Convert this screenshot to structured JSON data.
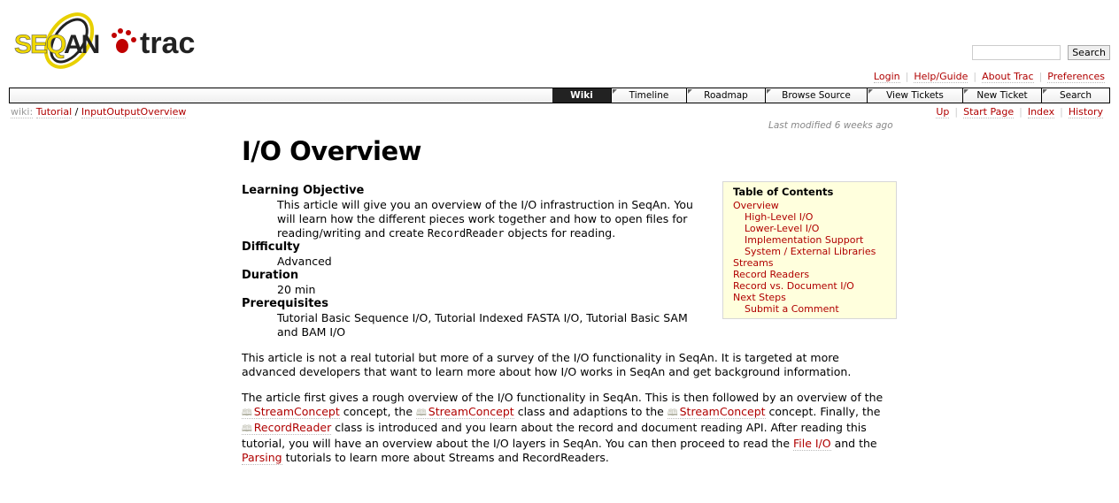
{
  "logo": {
    "text_a": "SEQAN",
    "text_b": "trac"
  },
  "search": {
    "placeholder": "",
    "button": "Search"
  },
  "metanav": [
    "Login",
    "Help/Guide",
    "About Trac",
    "Preferences"
  ],
  "mainnav": [
    "Wiki",
    "Timeline",
    "Roadmap",
    "Browse Source",
    "View Tickets",
    "New Ticket",
    "Search"
  ],
  "breadcrumb": {
    "label": "wiki:",
    "items": [
      "Tutorial",
      "InputOutputOverview"
    ],
    "sep": "/"
  },
  "ctxnav": [
    "Up",
    "Start Page",
    "Index",
    "History"
  ],
  "last_modified": "Last modified 6 weeks ago",
  "title": "I/O Overview",
  "meta": [
    {
      "term": "Learning Objective",
      "pre": "This article will give you an overview of the I/O infrastruction in SeqAn. You will learn how the different pieces work together and how to open files for reading/writing and create ",
      "code": "RecordReader",
      "post": " objects for reading."
    },
    {
      "term": "Difficulty",
      "pre": "Advanced"
    },
    {
      "term": "Duration",
      "pre": "20 min"
    },
    {
      "term": "Prerequisites",
      "pre": "Tutorial Basic Sequence I/O, Tutorial Indexed FASTA I/O, Tutorial Basic SAM and BAM I/O"
    }
  ],
  "para1": "This article is not a real tutorial but more of a survey of the I/O functionality in SeqAn. It is targeted at more advanced developers that want to learn more about how I/O works in SeqAn and get background information.",
  "para2": {
    "t1": "The article first gives a rough overview of the I/O functionality in SeqAn. This is then followed by an overview of the ",
    "l1": "StreamConcept",
    "t2": " concept, the ",
    "l2": "StreamConcept",
    "t3": " class and adaptions to the ",
    "l3": "StreamConcept",
    "t4": " concept. Finally, the ",
    "l4": "RecordReader",
    "t5": " class is introduced and you learn about the record and document reading API. After reading this tutorial, you will have an overview about the I/O layers in SeqAn. You can then proceed to read the ",
    "l5": "File I/O",
    "t6": " and the ",
    "l6": "Parsing",
    "t7": " tutorials to learn more about Streams and RecordReaders."
  },
  "toc": {
    "title": "Table of Contents",
    "items": [
      {
        "label": "Overview",
        "level": 1
      },
      {
        "label": "High-Level I/O",
        "level": 2
      },
      {
        "label": "Lower-Level I/O",
        "level": 2
      },
      {
        "label": "Implementation Support",
        "level": 2
      },
      {
        "label": "System / External Libraries",
        "level": 2
      },
      {
        "label": "Streams",
        "level": 1
      },
      {
        "label": "Record Readers",
        "level": 1
      },
      {
        "label": "Record vs. Document I/O",
        "level": 1
      },
      {
        "label": "Next Steps",
        "level": 1
      },
      {
        "label": "Submit a Comment",
        "level": 2
      }
    ]
  }
}
